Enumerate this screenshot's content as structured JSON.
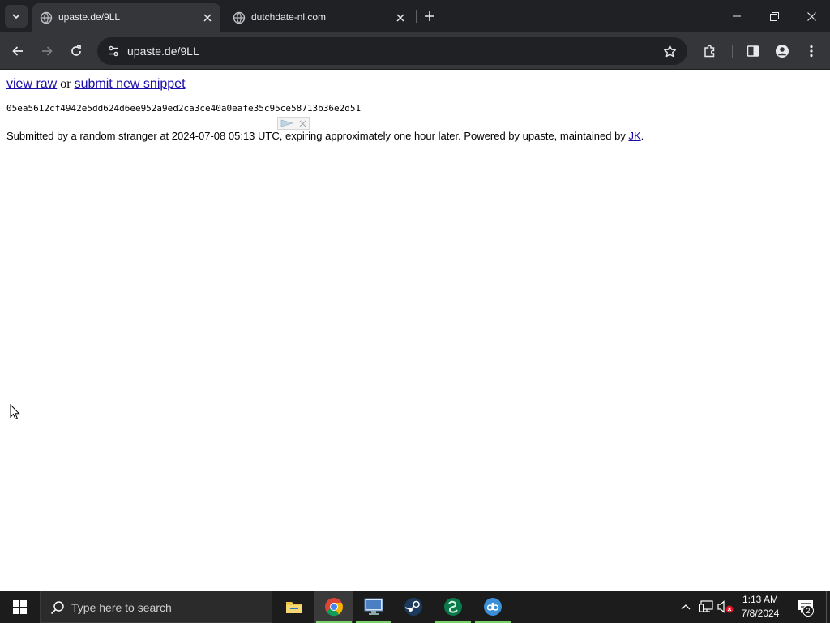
{
  "browser": {
    "tabs": [
      {
        "title": "upaste.de/9LL",
        "active": true
      },
      {
        "title": "dutchdate-nl.com",
        "active": false
      }
    ],
    "address_bar": {
      "url": "upaste.de/9LL"
    }
  },
  "page": {
    "links": {
      "view_raw": "view raw",
      "separator": " or ",
      "submit_new": "submit new snippet"
    },
    "snippet": "05ea5612cf4942e5dd624d6ee952a9ed2ca3ce40a0eafe35c95ce58713b36e2d51",
    "footer": {
      "text": "Submitted by a random stranger at 2024-07-08 05:13 UTC, expiring approximately one hour later. Powered by upaste, maintained by ",
      "link": "JK",
      "end": "."
    }
  },
  "taskbar": {
    "search_placeholder": "Type here to search",
    "apps": [
      "file-explorer",
      "chrome",
      "remote-desktop",
      "steam",
      "app-green",
      "qbittorrent"
    ],
    "clock": {
      "time": "1:13 AM",
      "date": "7/8/2024"
    },
    "notification_count": "2"
  },
  "colors": {
    "link": "#1a0dab",
    "chrome_dark": "#202124",
    "chrome_toolbar": "#35363a",
    "taskbar": "#1c1c1c"
  }
}
